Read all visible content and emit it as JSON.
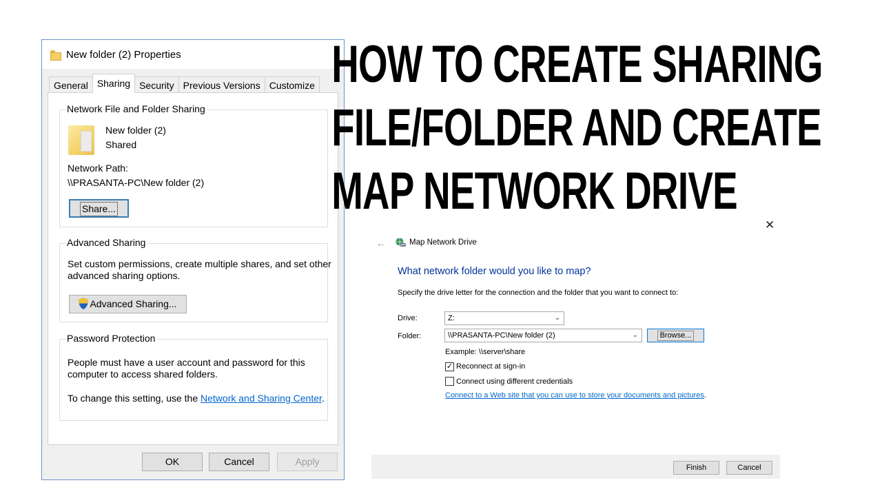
{
  "headline": {
    "line1": "HOW TO CREATE SHARING",
    "line2": "FILE/FOLDER AND CREATE",
    "line3": "MAP NETWORK DRIVE"
  },
  "properties": {
    "title": "New folder (2) Properties",
    "tabs": [
      "General",
      "Sharing",
      "Security",
      "Previous Versions",
      "Customize"
    ],
    "active_tab": "Sharing",
    "network_sharing": {
      "group_label": "Network File and Folder Sharing",
      "folder_name": "New folder (2)",
      "folder_state": "Shared",
      "path_label": "Network Path:",
      "path_value": "\\\\PRASANTA-PC\\New folder (2)",
      "share_button": "Share..."
    },
    "advanced_sharing": {
      "group_label": "Advanced Sharing",
      "description_line1": "Set custom permissions, create multiple shares, and set other",
      "description_line2": "advanced sharing options.",
      "button": "Advanced Sharing..."
    },
    "password_protection": {
      "group_label": "Password Protection",
      "line1": "People must have a user account and password for this",
      "line2": "computer to access shared folders.",
      "change_prefix": "To change this setting, use the ",
      "link": "Network and Sharing Center",
      "change_suffix": "."
    },
    "buttons": {
      "ok": "OK",
      "cancel": "Cancel",
      "apply": "Apply"
    }
  },
  "map_drive": {
    "title": "Map Network Drive",
    "close_glyph": "✕",
    "back_glyph": "←",
    "heading": "What network folder would you like to map?",
    "description": "Specify the drive letter for the connection and the folder that you want to connect to:",
    "drive_label": "Drive:",
    "drive_value": "Z:",
    "folder_label": "Folder:",
    "folder_value": "\\\\PRASANTA-PC\\New folder (2)",
    "browse_button": "Browse...",
    "example": "Example: \\\\server\\share",
    "reconnect_label": "Reconnect at sign-in",
    "reconnect_checked": true,
    "different_credentials_label": "Connect using different credentials",
    "different_credentials_checked": false,
    "web_link": "Connect to a Web site that you can use to store your documents and pictures",
    "web_link_suffix": ".",
    "finish_button": "Finish",
    "cancel_button": "Cancel"
  },
  "colors": {
    "link": "#0066cc",
    "wizard_heading": "#003399",
    "dialog_border": "#6d94c4"
  }
}
